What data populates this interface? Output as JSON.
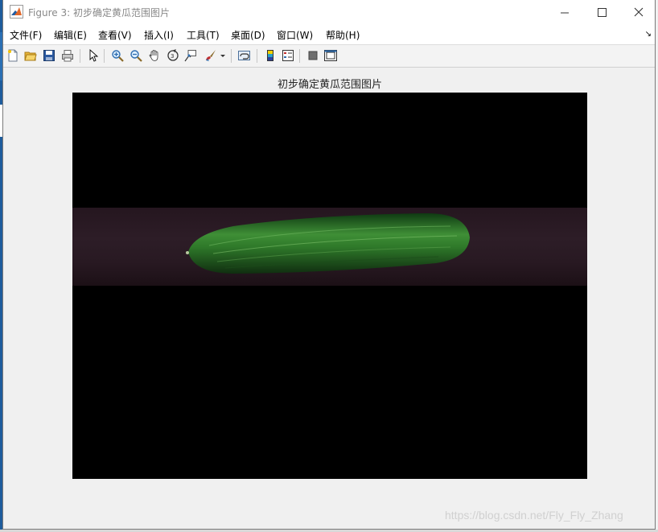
{
  "window": {
    "title": "Figure 3: 初步确定黄瓜范围图片",
    "buttons": [
      "minimize-icon",
      "maximize-icon",
      "close-icon"
    ]
  },
  "menubar": {
    "items": [
      "文件(F)",
      "编辑(E)",
      "查看(V)",
      "插入(I)",
      "工具(T)",
      "桌面(D)",
      "窗口(W)",
      "帮助(H)"
    ],
    "overflow_icon": "dock-arrow-icon"
  },
  "toolbar": {
    "icons": [
      "new-figure-icon",
      "open-file-icon",
      "save-icon",
      "print-icon",
      "edit-plot-icon",
      "zoom-in-icon",
      "zoom-out-icon",
      "pan-icon",
      "rotate-3d-icon",
      "data-cursor-icon",
      "brush-icon",
      "brush-dropdown-icon",
      "link-plot-icon",
      "insert-colorbar-icon",
      "insert-legend-icon",
      "hide-plot-tools-icon",
      "show-plot-tools-icon"
    ]
  },
  "figure": {
    "axes_title": "初步确定黄瓜范围图片",
    "image_description_colors": {
      "background": "#000000",
      "band": "#2a1b24",
      "cucumber": "#2f7a2a"
    }
  },
  "watermark": "https://blog.csdn.net/Fly_Fly_Zhang"
}
